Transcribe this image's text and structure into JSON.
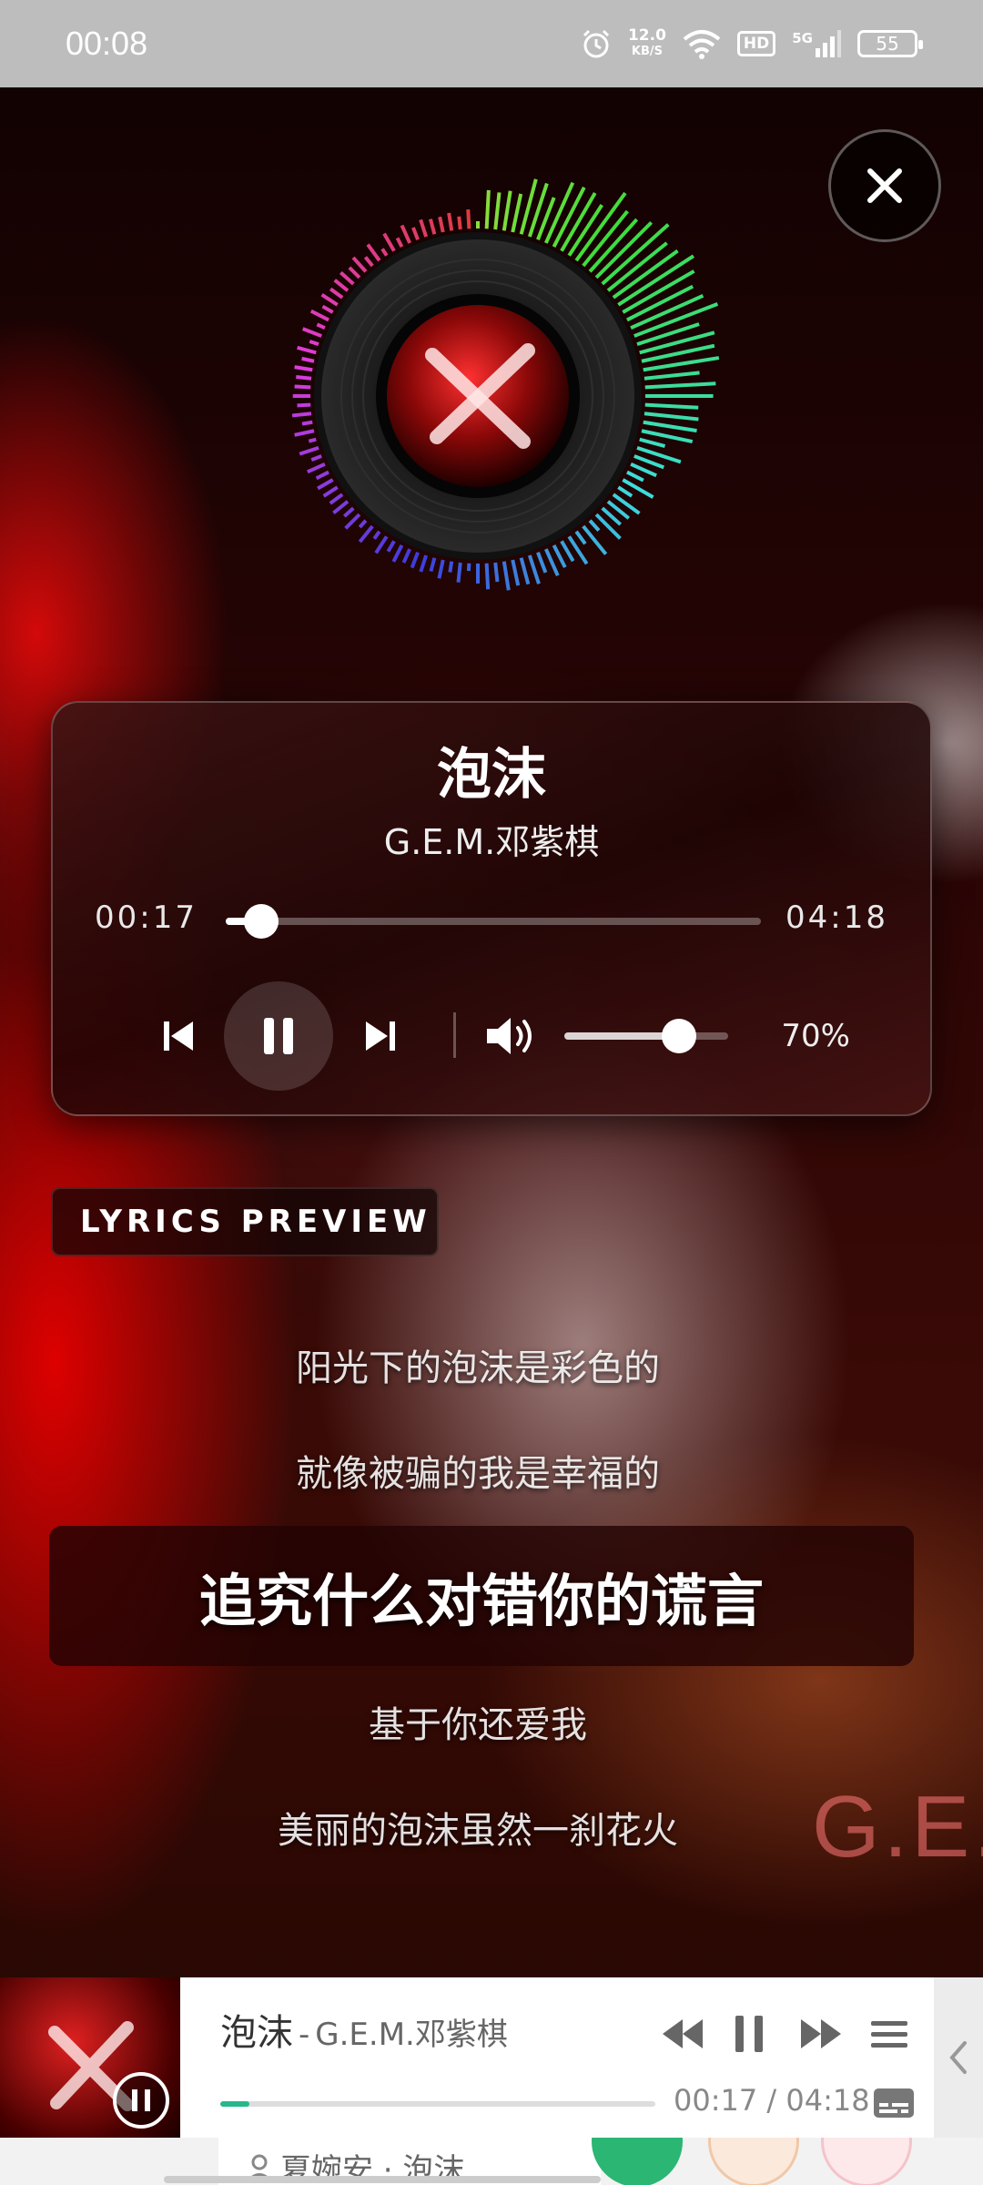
{
  "status_bar": {
    "time": "00:08",
    "net_speed_value": "12.0",
    "net_speed_unit": "KB/S",
    "hd": "HD",
    "signal": "5G",
    "battery": "55"
  },
  "player": {
    "title": "泡沫",
    "artist": "G.E.M.邓紫棋",
    "current_time": "00:17",
    "total_time": "04:18",
    "progress": 0.066,
    "volume_label": "70%",
    "volume": 0.7
  },
  "lyrics": {
    "tag": "LYRICS PREVIEW",
    "lines": [
      "阳光下的泡沫是彩色的",
      "就像被骗的我是幸福的"
    ],
    "active": "追究什么对错你的谎言",
    "after": [
      "基于你还爱我",
      "美丽的泡沫虽然一刹花火"
    ]
  },
  "background": {
    "watermark": "G.E."
  },
  "mini_player": {
    "title": "泡沫",
    "separator": "-",
    "artist": "G.E.M.邓紫棋",
    "time": "00:17 / 04:18",
    "progress": 0.066
  },
  "bottom": {
    "label": "夏婉安 · 泡沫"
  },
  "colors": {
    "accent_green": "#28b78a",
    "status_bar": "#bdbdbd"
  }
}
